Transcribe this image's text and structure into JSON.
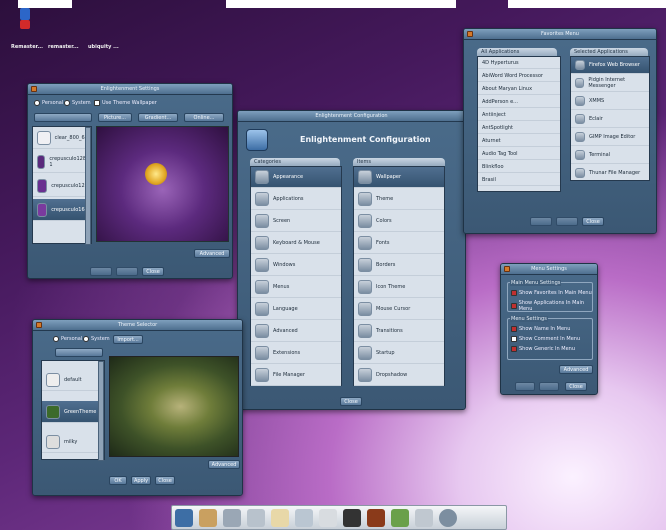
{
  "desktop": {
    "icons": [
      {
        "label": "Remaster..."
      },
      {
        "label": "remaster..."
      },
      {
        "label": "ubiquity ..."
      }
    ]
  },
  "wallpaper_win": {
    "title": "Enlightenment Settings",
    "radio_personal": "Personal",
    "radio_system": "System",
    "use_theme": "Use Theme Wallpaper",
    "picture_btn": "Picture...",
    "gradient_btn": "Gradient...",
    "online_btn": "Online...",
    "items": [
      "clear_800_600",
      "crepusculo1280-1",
      "crepusculo1280",
      "crepusculo1600"
    ],
    "advanced": "Advanced",
    "close": "Close"
  },
  "config_win": {
    "title": "Enlightenment Configuration",
    "heading": "Enlightenment Configuration",
    "categories_label": "Categories",
    "items_label": "Items",
    "categories": [
      "Appearance",
      "Applications",
      "Screen",
      "Keyboard & Mouse",
      "Windows",
      "Menus",
      "Language",
      "Advanced",
      "Extensions",
      "File Manager"
    ],
    "items": [
      "Wallpaper",
      "Theme",
      "Colors",
      "Fonts",
      "Borders",
      "Icon Theme",
      "Mouse Cursor",
      "Transitions",
      "Startup",
      "Dropshadow"
    ],
    "close": "Close"
  },
  "fav_win": {
    "title": "Favorites Menu",
    "all_label": "All Applications",
    "selected_label": "Selected Applications",
    "all": [
      "4D Hyperturus",
      "AbiWord Word Processor",
      "About Maryan Linux",
      "AddPerson e...",
      "Antiinject",
      "AntSpotlight",
      "Aturnet",
      "Audio Tag Tool",
      "Blinkfloo",
      "Brasil"
    ],
    "selected": [
      "Firefox Web Browser",
      "Pidgin Internet Messenger",
      "XMMS",
      "Eclair",
      "GIMP Image Editor",
      "Terminal",
      "Thunar File Manager"
    ],
    "close": "Close"
  },
  "menu_win": {
    "title": "Menu Settings",
    "main_label": "Main Menu Settings",
    "show_fav": "Show Favorites In Main Menu",
    "show_apps": "Show Applications In Main Menu",
    "menu_label": "Menu Settings",
    "show_name": "Show Name In Menu",
    "show_comment": "Show Comment In Menu",
    "show_generic": "Show Generic In Menu",
    "advanced": "Advanced",
    "close": "Close"
  },
  "theme_win": {
    "title": "Theme Selector",
    "radio_personal": "Personal",
    "radio_system": "System",
    "import_btn": "Import...",
    "items": [
      "default",
      "GreenTheme",
      "milky"
    ],
    "advanced": "Advanced",
    "ok": "OK",
    "apply": "Apply",
    "close": "Close"
  },
  "colors": {
    "accent": "#4e6f8f",
    "selected": "#355370"
  }
}
